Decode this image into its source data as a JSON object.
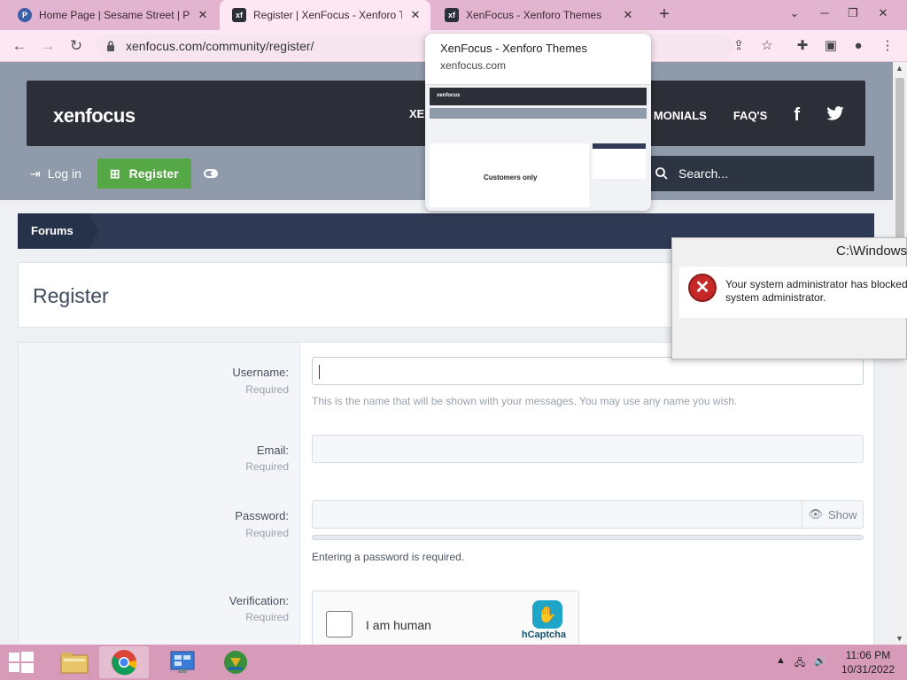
{
  "browser": {
    "tabs": [
      {
        "title": "Home Page | Sesame Street | PBS",
        "icon": "pbs-kids-icon",
        "active": false
      },
      {
        "title": "Register | XenFocus - Xenforo Themes",
        "icon": "xf-icon",
        "active": true
      },
      {
        "title": "XenFocus - Xenforo Themes",
        "icon": "xf-icon",
        "active": false
      }
    ],
    "url": "xenfocus.com/community/register/",
    "hover_card": {
      "title": "XenFocus - Xenforo Themes",
      "domain": "xenfocus.com",
      "thumbnail_logo": "xenfocus",
      "thumbnail_caption": "Customers only"
    }
  },
  "site": {
    "logo_left": "xen",
    "logo_right": "focus",
    "nav_partial_left": "XE",
    "nav_partial_right": "MONIALS",
    "nav_faq": "FAQ'S",
    "login_label": "Log in",
    "register_label": "Register",
    "search_placeholder": "Search...",
    "breadcrumb": "Forums"
  },
  "form": {
    "page_title": "Register",
    "username_label": "Username:",
    "username_required": "Required",
    "username_hint": "This is the name that will be shown with your messages. You may use any name you wish.",
    "email_label": "Email:",
    "email_required": "Required",
    "password_label": "Password:",
    "password_required": "Required",
    "show_label": "Show",
    "password_message": "Entering a password is required.",
    "verification_label": "Verification:",
    "verification_required": "Required",
    "captcha_text": "I am human",
    "captcha_brand": "hCaptcha"
  },
  "error_dialog": {
    "title": "C:\\Windows\\",
    "message_line1": "Your system administrator has blocked",
    "message_line2": "system administrator."
  },
  "taskbar": {
    "time": "11:06 PM",
    "date": "10/31/2022"
  },
  "colors": {
    "tabstrip": "#e3b4cf",
    "register_button": "#56a847",
    "header": "#2d2f38",
    "breadcrumb": "#2e3a54"
  }
}
